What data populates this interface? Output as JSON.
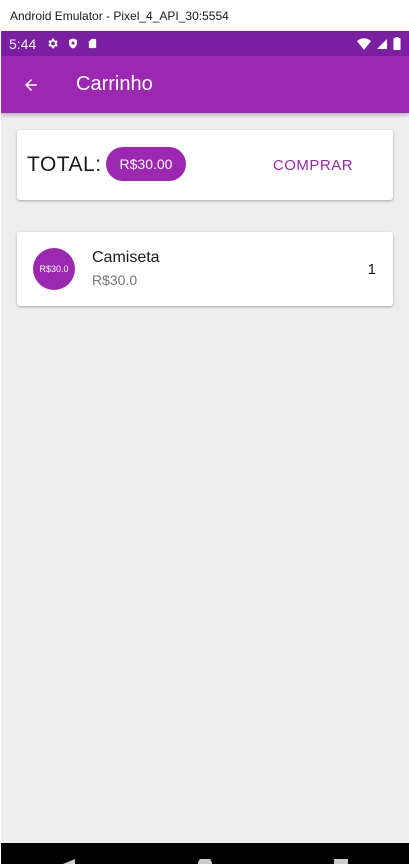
{
  "window": {
    "title": "Android Emulator - Pixel_4_API_30:5554"
  },
  "status_bar": {
    "time": "5:44",
    "left_icons": [
      "gear-icon",
      "shield-icon",
      "sd-card-icon"
    ],
    "right_icons": [
      "wifi-icon",
      "signal-icon",
      "battery-icon"
    ],
    "color": "#7b1fa2"
  },
  "app_bar": {
    "title": "Carrinho",
    "back_icon": "arrow-left-icon",
    "color": "#9c27b0"
  },
  "total_card": {
    "label": "TOTAL:",
    "amount": "R$30.00",
    "buy_label": "COMPRAR"
  },
  "cart": {
    "items": [
      {
        "avatar_text": "R$30.0",
        "name": "Camiseta",
        "price": "R$30.0",
        "quantity": "1"
      }
    ]
  },
  "nav_bar": {
    "icons": [
      "back-triangle-icon",
      "home-circle-icon",
      "recents-square-icon"
    ]
  }
}
